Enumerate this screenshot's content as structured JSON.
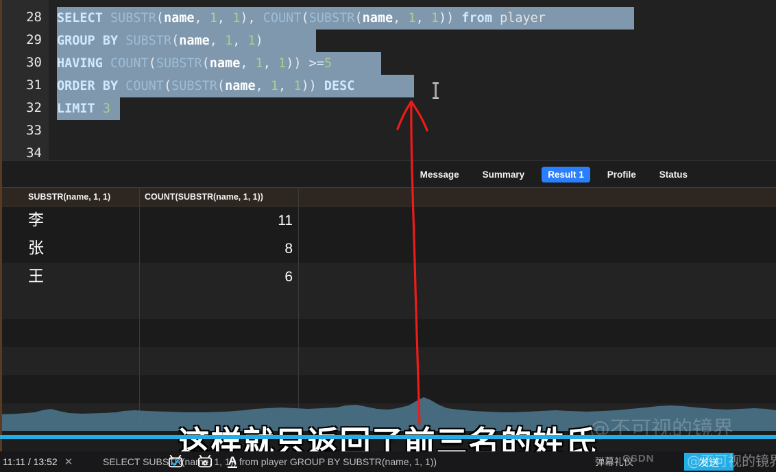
{
  "editor": {
    "first_line_number": 28,
    "lines": [
      {
        "num": "28",
        "selected": true,
        "sel_width": 842,
        "tokens": [
          {
            "t": "SELECT",
            "c": "kw"
          },
          {
            "t": " ",
            "c": "plain"
          },
          {
            "t": "SUBSTR",
            "c": "fn"
          },
          {
            "t": "(",
            "c": "pun"
          },
          {
            "t": "name",
            "c": "id"
          },
          {
            "t": ", ",
            "c": "pun"
          },
          {
            "t": "1",
            "c": "num"
          },
          {
            "t": ", ",
            "c": "pun"
          },
          {
            "t": "1",
            "c": "num"
          },
          {
            "t": "), ",
            "c": "pun"
          },
          {
            "t": "COUNT",
            "c": "fn"
          },
          {
            "t": "(",
            "c": "pun"
          },
          {
            "t": "SUBSTR",
            "c": "fn"
          },
          {
            "t": "(",
            "c": "pun"
          },
          {
            "t": "name",
            "c": "id"
          },
          {
            "t": ", ",
            "c": "pun"
          },
          {
            "t": "1",
            "c": "num"
          },
          {
            "t": ", ",
            "c": "pun"
          },
          {
            "t": "1",
            "c": "num"
          },
          {
            "t": ")) ",
            "c": "pun"
          },
          {
            "t": "from",
            "c": "kw"
          },
          {
            "t": " ",
            "c": "plain"
          },
          {
            "t": "player",
            "c": "plain"
          }
        ]
      },
      {
        "num": "29",
        "selected": true,
        "sel_width": 378,
        "tokens": [
          {
            "t": "GROUP BY",
            "c": "kw"
          },
          {
            "t": " ",
            "c": "plain"
          },
          {
            "t": "SUBSTR",
            "c": "fn"
          },
          {
            "t": "(",
            "c": "pun"
          },
          {
            "t": "name",
            "c": "id"
          },
          {
            "t": ", ",
            "c": "pun"
          },
          {
            "t": "1",
            "c": "num"
          },
          {
            "t": ", ",
            "c": "pun"
          },
          {
            "t": "1",
            "c": "num"
          },
          {
            "t": ")",
            "c": "pun"
          }
        ]
      },
      {
        "num": "30",
        "selected": true,
        "sel_width": 473,
        "tokens": [
          {
            "t": "HAVING",
            "c": "kw"
          },
          {
            "t": " ",
            "c": "plain"
          },
          {
            "t": "COUNT",
            "c": "fn"
          },
          {
            "t": "(",
            "c": "pun"
          },
          {
            "t": "SUBSTR",
            "c": "fn"
          },
          {
            "t": "(",
            "c": "pun"
          },
          {
            "t": "name",
            "c": "id"
          },
          {
            "t": ", ",
            "c": "pun"
          },
          {
            "t": "1",
            "c": "num"
          },
          {
            "t": ", ",
            "c": "pun"
          },
          {
            "t": "1",
            "c": "num"
          },
          {
            "t": ")) ",
            "c": "pun"
          },
          {
            "t": ">=",
            "c": "pun"
          },
          {
            "t": "5",
            "c": "num"
          }
        ]
      },
      {
        "num": "31",
        "selected": true,
        "sel_width": 521,
        "tokens": [
          {
            "t": "ORDER BY",
            "c": "kw"
          },
          {
            "t": " ",
            "c": "plain"
          },
          {
            "t": "COUNT",
            "c": "fn"
          },
          {
            "t": "(",
            "c": "pun"
          },
          {
            "t": "SUBSTR",
            "c": "fn"
          },
          {
            "t": "(",
            "c": "pun"
          },
          {
            "t": "name",
            "c": "id"
          },
          {
            "t": ", ",
            "c": "pun"
          },
          {
            "t": "1",
            "c": "num"
          },
          {
            "t": ", ",
            "c": "pun"
          },
          {
            "t": "1",
            "c": "num"
          },
          {
            "t": ")) ",
            "c": "pun"
          },
          {
            "t": "DESC",
            "c": "kw"
          }
        ]
      },
      {
        "num": "32",
        "selected": true,
        "sel_width": 92,
        "tokens": [
          {
            "t": "LIMIT",
            "c": "kw"
          },
          {
            "t": " ",
            "c": "plain"
          },
          {
            "t": "3",
            "c": "num"
          }
        ]
      },
      {
        "num": "33",
        "selected": false,
        "sel_width": 0,
        "tokens": []
      },
      {
        "num": "34",
        "selected": false,
        "sel_width": 0,
        "tokens": []
      }
    ]
  },
  "result_panel": {
    "tabs": [
      {
        "label": "Message",
        "active": false
      },
      {
        "label": "Summary",
        "active": false
      },
      {
        "label": "Result 1",
        "active": true
      },
      {
        "label": "Profile",
        "active": false
      },
      {
        "label": "Status",
        "active": false
      }
    ],
    "active_tab": "Result 1",
    "accent_color": "#2a7fff",
    "columns": [
      "SUBSTR(name, 1, 1)",
      "COUNT(SUBSTR(name, 1, 1))"
    ],
    "rows": [
      {
        "surname": "李",
        "count": "11"
      },
      {
        "surname": "张",
        "count": "8"
      },
      {
        "surname": "王",
        "count": "6"
      }
    ],
    "empty_row_count": 5
  },
  "annotation": {
    "type": "hand-drawn-arrow",
    "color": "#ee1b1b",
    "points_to": "end of LIMIT 3 statement"
  },
  "subtitle": {
    "text": "这样就只返回了前三名的姓氏"
  },
  "player": {
    "current_time": "11:11",
    "separator": "/",
    "total_time": "13:52",
    "close_label": "✕",
    "progress_percent": 100,
    "progress_color": "#23ade5",
    "danmaku_placeholder": "SELECT SUBSTR(name, 1, 1)) from player GROUP BY SUBSTR(name, 1, 1))",
    "danmaku_hint": "弹幕礼仪",
    "send_label": "发送",
    "icons": [
      "danmaku-tv-on-icon",
      "danmaku-settings-icon",
      "font-size-icon"
    ]
  },
  "watermarks": {
    "site": "CSDN",
    "user": "@不可视的镜界",
    "overlay_big": "@不可视的镜界"
  }
}
